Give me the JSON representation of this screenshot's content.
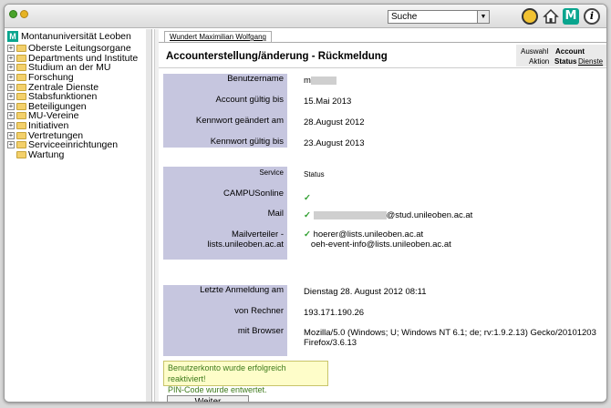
{
  "toolbar": {
    "search_value": "Suche",
    "icons": [
      "key-icon",
      "home-icon",
      "mu-logo-icon",
      "info-icon"
    ]
  },
  "nav": {
    "root": "Montanuniversität Leoben",
    "items": [
      "Oberste Leitungsorgane",
      "Departments und Institute",
      "Studium an der MU",
      "Forschung",
      "Zentrale Dienste",
      "Stabsfunktionen",
      "Beteiligungen",
      "MU-Vereine",
      "Initiativen",
      "Vertretungen",
      "Serviceeinrichtungen"
    ],
    "leaf": "Wartung"
  },
  "content": {
    "user_tab": "Wundert Maximilian Wolfgang",
    "title": "Accounterstellung/änderung - Rückmeldung",
    "action_panel": {
      "auswahl": "Auswahl",
      "account": "Account",
      "aktion": "Aktion",
      "status": "Status",
      "dienste": "Dienste"
    },
    "account": {
      "benutzername_label": "Benutzername",
      "benutzername_value": "m",
      "gueltig_label": "Account gültig bis",
      "gueltig_value": "15.Mai 2013",
      "kennwort_geaendert_label": "Kennwort geändert am",
      "kennwort_geaendert_value": "28.August 2012",
      "kennwort_gueltig_label": "Kennwort gültig bis",
      "kennwort_gueltig_value": "23.August 2013"
    },
    "services": {
      "service_label": "Service",
      "status_label": "Status",
      "campus_label": "CAMPUSonline",
      "mail_label": "Mail",
      "mail_domain": "@stud.unileoben.ac.at",
      "verteiler_label_1": "Mailverteiler -",
      "verteiler_label_2": "lists.unileoben.ac.at",
      "verteiler_1": "hoerer@lists.unileoben.ac.at",
      "verteiler_2": "oeh-event-info@lists.unileoben.ac.at",
      "check": "✓"
    },
    "login": {
      "letzte_label": "Letzte Anmeldung am",
      "letzte_value": "Dienstag 28. August 2012 08:11",
      "rechner_label": "von Rechner",
      "rechner_value": "193.171.190.26",
      "browser_label": "mit Browser",
      "browser_value_1": "Mozilla/5.0 (Windows; U; Windows NT 6.1; de; rv:1.9.2.13) Gecko/20101203",
      "browser_value_2": "Firefox/3.6.13"
    },
    "message_1": "Benutzerkonto wurde erfolgreich reaktiviert!",
    "message_2": "PIN-Code wurde entwertet.",
    "weiter_label": "Weiter"
  }
}
